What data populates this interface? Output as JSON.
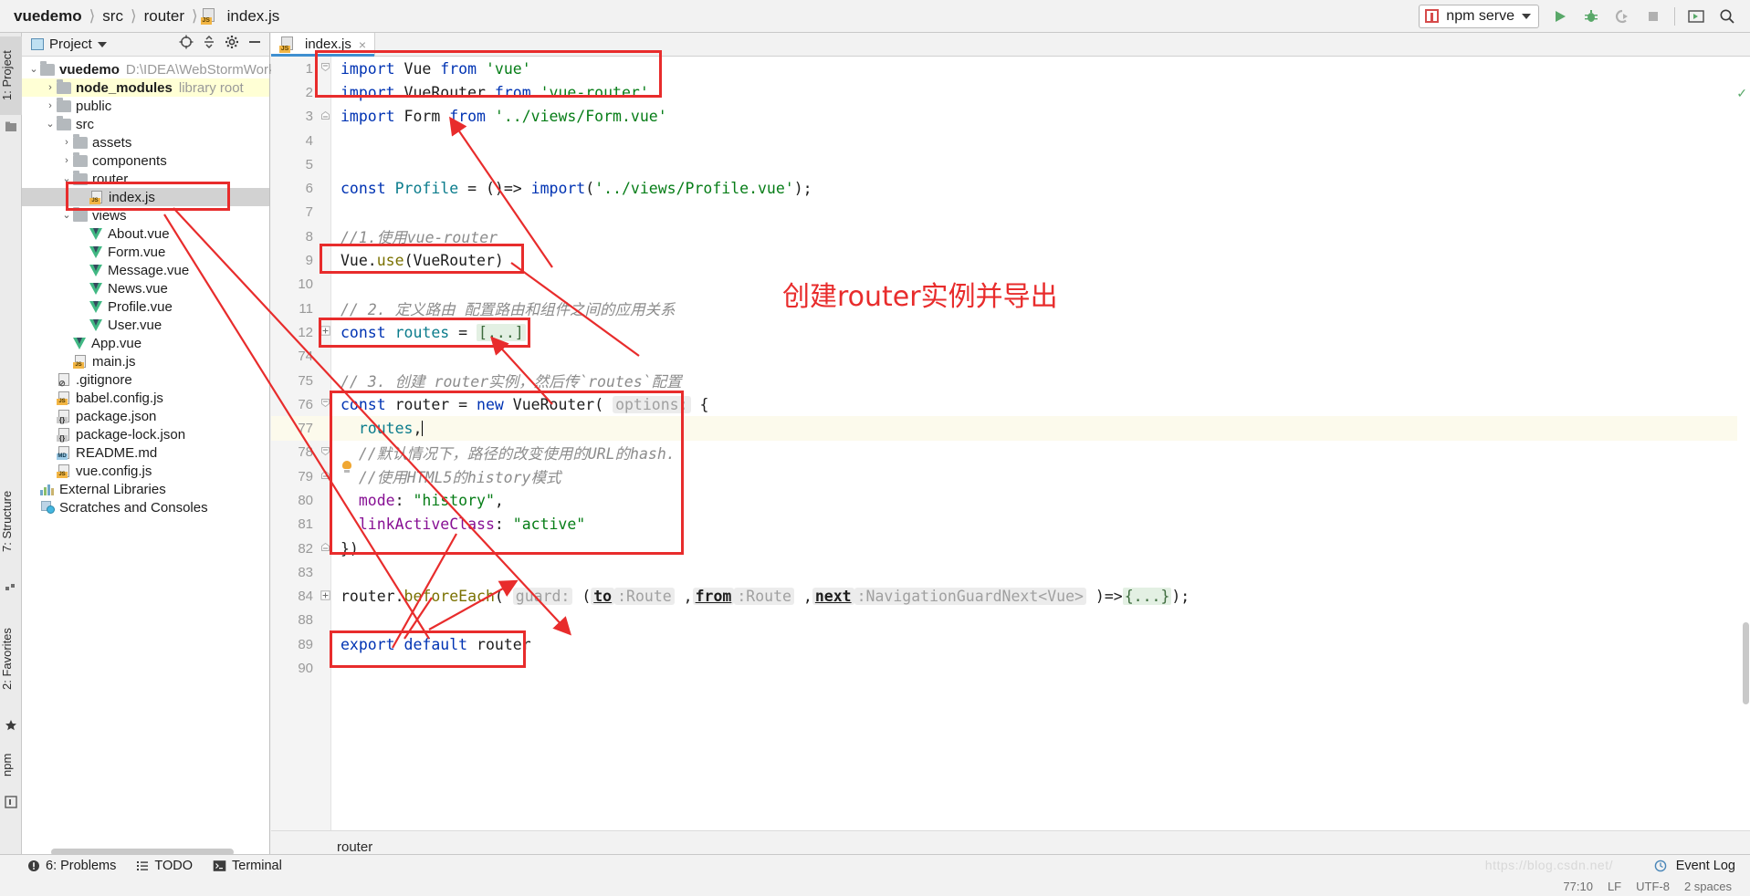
{
  "window": {
    "breadcrumb": [
      "vuedemo",
      "src",
      "router",
      "index.js"
    ]
  },
  "toolbar": {
    "run_config": "npm serve",
    "icons": [
      "run-icon",
      "debug-icon",
      "coverage-icon",
      "stop-icon",
      "terminal-icon",
      "search-icon"
    ]
  },
  "project_panel": {
    "title": "Project",
    "header_icons": [
      "locate-icon",
      "collapse-all-icon",
      "settings-icon",
      "hide-icon"
    ],
    "tree": [
      {
        "label": "vuedemo",
        "suffix": "D:\\IDEA\\WebStormWorkSpa",
        "depth": 0,
        "arrow": "v",
        "icon": "folder",
        "bold": true
      },
      {
        "label": "node_modules",
        "suffix": "library root",
        "depth": 1,
        "arrow": ">",
        "icon": "folder",
        "bold": true,
        "highlight": "yellow"
      },
      {
        "label": "public",
        "suffix": "",
        "depth": 1,
        "arrow": ">",
        "icon": "folder"
      },
      {
        "label": "src",
        "suffix": "",
        "depth": 1,
        "arrow": "v",
        "icon": "folder"
      },
      {
        "label": "assets",
        "suffix": "",
        "depth": 2,
        "arrow": ">",
        "icon": "folder"
      },
      {
        "label": "components",
        "suffix": "",
        "depth": 2,
        "arrow": ">",
        "icon": "folder"
      },
      {
        "label": "router",
        "suffix": "",
        "depth": 2,
        "arrow": "v",
        "icon": "folder"
      },
      {
        "label": "index.js",
        "suffix": "",
        "depth": 3,
        "arrow": "",
        "icon": "js",
        "selected": true
      },
      {
        "label": "views",
        "suffix": "",
        "depth": 2,
        "arrow": "v",
        "icon": "folder"
      },
      {
        "label": "About.vue",
        "suffix": "",
        "depth": 3,
        "arrow": "",
        "icon": "vue"
      },
      {
        "label": "Form.vue",
        "suffix": "",
        "depth": 3,
        "arrow": "",
        "icon": "vue"
      },
      {
        "label": "Message.vue",
        "suffix": "",
        "depth": 3,
        "arrow": "",
        "icon": "vue"
      },
      {
        "label": "News.vue",
        "suffix": "",
        "depth": 3,
        "arrow": "",
        "icon": "vue"
      },
      {
        "label": "Profile.vue",
        "suffix": "",
        "depth": 3,
        "arrow": "",
        "icon": "vue"
      },
      {
        "label": "User.vue",
        "suffix": "",
        "depth": 3,
        "arrow": "",
        "icon": "vue"
      },
      {
        "label": "App.vue",
        "suffix": "",
        "depth": 2,
        "arrow": "",
        "icon": "vue"
      },
      {
        "label": "main.js",
        "suffix": "",
        "depth": 2,
        "arrow": "",
        "icon": "js"
      },
      {
        "label": ".gitignore",
        "suffix": "",
        "depth": 1,
        "arrow": "",
        "icon": "git"
      },
      {
        "label": "babel.config.js",
        "suffix": "",
        "depth": 1,
        "arrow": "",
        "icon": "js"
      },
      {
        "label": "package.json",
        "suffix": "",
        "depth": 1,
        "arrow": "",
        "icon": "json"
      },
      {
        "label": "package-lock.json",
        "suffix": "",
        "depth": 1,
        "arrow": "",
        "icon": "json"
      },
      {
        "label": "README.md",
        "suffix": "",
        "depth": 1,
        "arrow": "",
        "icon": "md"
      },
      {
        "label": "vue.config.js",
        "suffix": "",
        "depth": 1,
        "arrow": "",
        "icon": "js"
      },
      {
        "label": "External Libraries",
        "suffix": "",
        "depth": 0,
        "arrow": "",
        "icon": "extlib"
      },
      {
        "label": "Scratches and Consoles",
        "suffix": "",
        "depth": 0,
        "arrow": "",
        "icon": "scratch"
      }
    ]
  },
  "left_strips": {
    "top": [
      "1: Project"
    ],
    "bottom": [
      "7: Structure",
      "2: Favorites"
    ],
    "npm": "npm"
  },
  "editor": {
    "tab": {
      "label": "index.js",
      "close": "×"
    },
    "breadcrumb_bottom": "router",
    "lines": [
      {
        "no": "1",
        "fold": "v",
        "code": "import Vue from 'vue'"
      },
      {
        "no": "2",
        "fold": "",
        "code": "import VueRouter from 'vue-router'"
      },
      {
        "no": "3",
        "fold": "^",
        "code": "import Form from '../views/Form.vue'"
      },
      {
        "no": "4",
        "fold": "",
        "code": ""
      },
      {
        "no": "5",
        "fold": "",
        "code": ""
      },
      {
        "no": "6",
        "fold": "",
        "code": "const Profile = ()=> import('../views/Profile.vue');"
      },
      {
        "no": "7",
        "fold": "",
        "code": ""
      },
      {
        "no": "8",
        "fold": "",
        "code": "//1.使用vue-router"
      },
      {
        "no": "9",
        "fold": "",
        "code": "Vue.use(VueRouter)"
      },
      {
        "no": "10",
        "fold": "",
        "code": ""
      },
      {
        "no": "11",
        "fold": "",
        "code": "// 2. 定义路由 配置路由和组件之间的应用关系"
      },
      {
        "no": "12",
        "fold": "+",
        "code": "const routes = [...]"
      },
      {
        "no": "74",
        "fold": "",
        "code": ""
      },
      {
        "no": "75",
        "fold": "",
        "code": "// 3. 创建 router实例，然后传`routes`配置"
      },
      {
        "no": "76",
        "fold": "v",
        "code": "const router = new VueRouter( options: {"
      },
      {
        "no": "77",
        "fold": "",
        "code": "  routes,"
      },
      {
        "no": "78",
        "fold": "v",
        "code": "  //默认情况下，路径的改变使用的URL的hash."
      },
      {
        "no": "79",
        "fold": "^",
        "code": "  //使用HTML5的history模式"
      },
      {
        "no": "80",
        "fold": "",
        "code": "  mode: \"history\","
      },
      {
        "no": "81",
        "fold": "",
        "code": "  linkActiveClass: \"active\""
      },
      {
        "no": "82",
        "fold": "^",
        "code": "})"
      },
      {
        "no": "83",
        "fold": "",
        "code": ""
      },
      {
        "no": "84",
        "fold": "+",
        "code": "router.beforeEach( guard: (to :Route ,from :Route ,next :NavigationGuardNext<Vue> )=>{...});"
      },
      {
        "no": "88",
        "fold": "",
        "code": ""
      },
      {
        "no": "89",
        "fold": "",
        "code": "export default router"
      },
      {
        "no": "90",
        "fold": "",
        "code": ""
      }
    ]
  },
  "annotation": {
    "text": "创建router实例并导出",
    "color": "#e82c2c"
  },
  "bottom_bar": {
    "items": [
      {
        "label": "6: Problems",
        "icon": "error-icon"
      },
      {
        "label": "TODO",
        "icon": "todo-icon"
      },
      {
        "label": "Terminal",
        "icon": "terminal-icon"
      }
    ],
    "event_log": "Event Log"
  },
  "status_bar": {
    "position": "77:10",
    "line_sep": "LF",
    "encoding": "UTF-8",
    "indent": "2 spaces",
    "watermark": "https://blog.csdn.net/"
  }
}
